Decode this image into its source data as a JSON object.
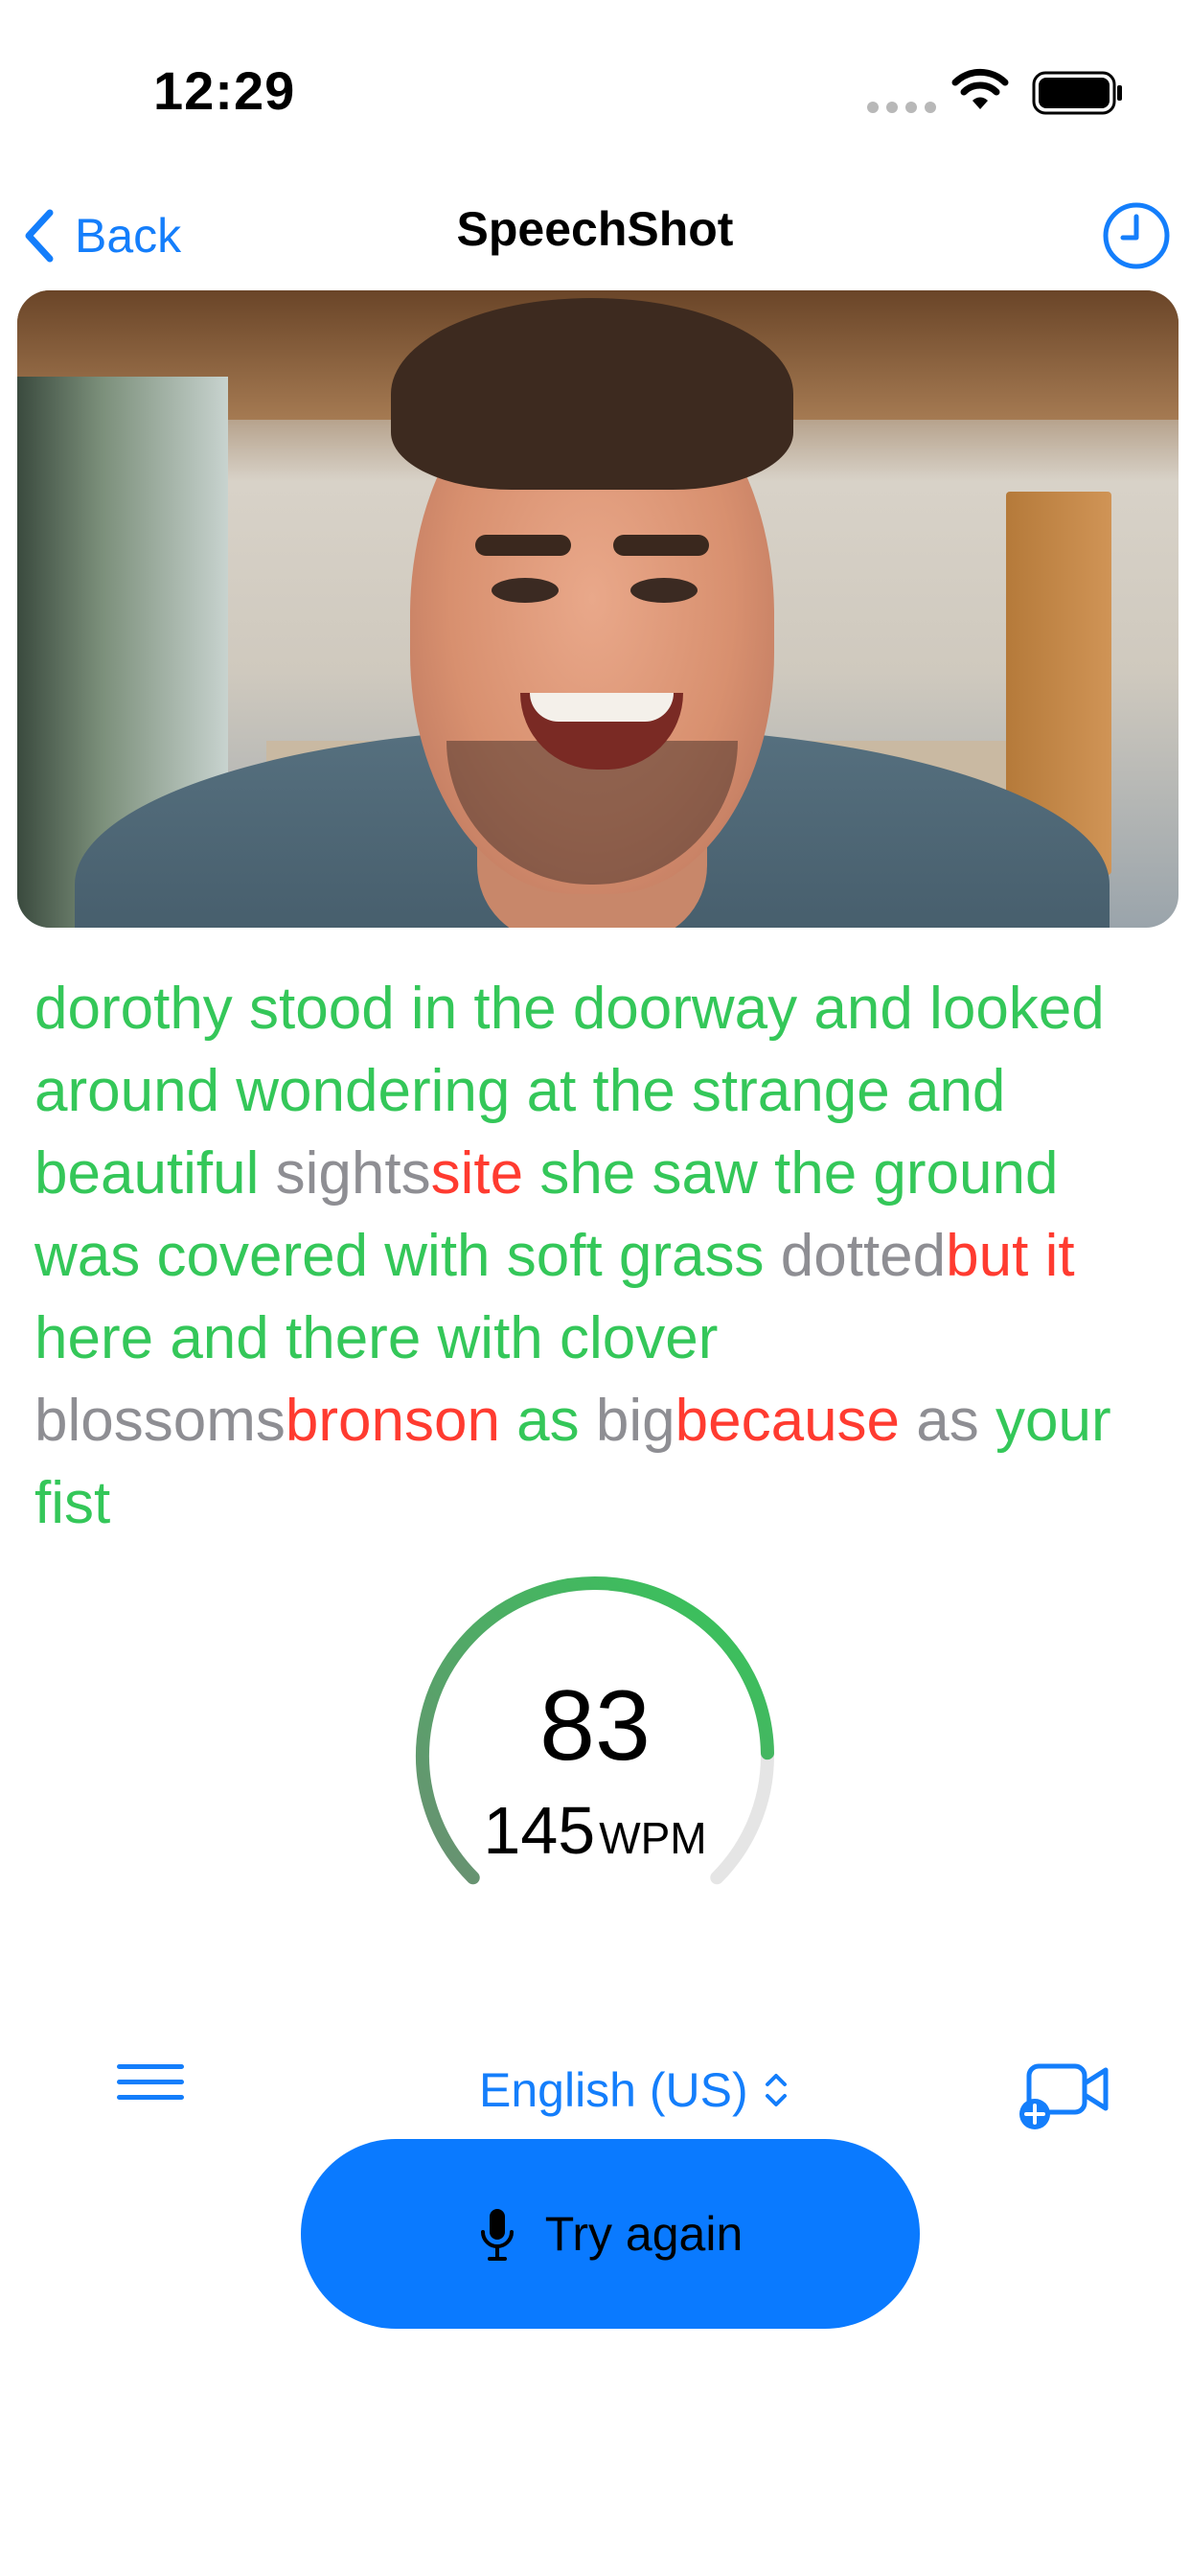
{
  "status_bar": {
    "time": "12:29",
    "icons": [
      "signal-dots-icon",
      "wifi-icon",
      "battery-icon"
    ]
  },
  "nav": {
    "back_label": "Back",
    "title": "SpeechShot",
    "right_icon": "history-clock-icon"
  },
  "photo": {
    "description_icon": "selfie-photo"
  },
  "transcript": [
    {
      "text": " dorothy stood in the doorway and looked around wondering at the strange and beautiful ",
      "status": "correct"
    },
    {
      "text": "sights",
      "status": "missed"
    },
    {
      "text": "site",
      "status": "wrong"
    },
    {
      "text": " she saw the ground was covered with soft grass ",
      "status": "correct"
    },
    {
      "text": "dotted",
      "status": "missed"
    },
    {
      "text": "but it",
      "status": "wrong"
    },
    {
      "text": " here and there with clover ",
      "status": "correct"
    },
    {
      "text": "blossoms",
      "status": "missed"
    },
    {
      "text": "bronson",
      "status": "wrong"
    },
    {
      "text": " as ",
      "status": "correct"
    },
    {
      "text": "big",
      "status": "missed"
    },
    {
      "text": "because",
      "status": "wrong"
    },
    {
      "text": " as ",
      "status": "missed"
    },
    {
      "text": "your fist",
      "status": "correct"
    }
  ],
  "gauge": {
    "score": "83",
    "wpm_value": "145",
    "wpm_unit": "WPM",
    "score_fraction": 0.83
  },
  "controls": {
    "menu_icon": "hamburger-menu-icon",
    "language": "English (US)",
    "language_icon": "up-down-chevron-icon",
    "camera_icon": "add-video-icon",
    "try_again_label": "Try again",
    "try_again_icon": "microphone-icon"
  },
  "colors": {
    "accent": "#147efb",
    "button": "#0a7aff",
    "correct": "#34c759",
    "missed": "#8e8e93",
    "wrong": "#ff3b30",
    "gauge_start": "#6b8f73",
    "gauge_end": "#34c759",
    "gauge_track": "#e5e5e5"
  }
}
